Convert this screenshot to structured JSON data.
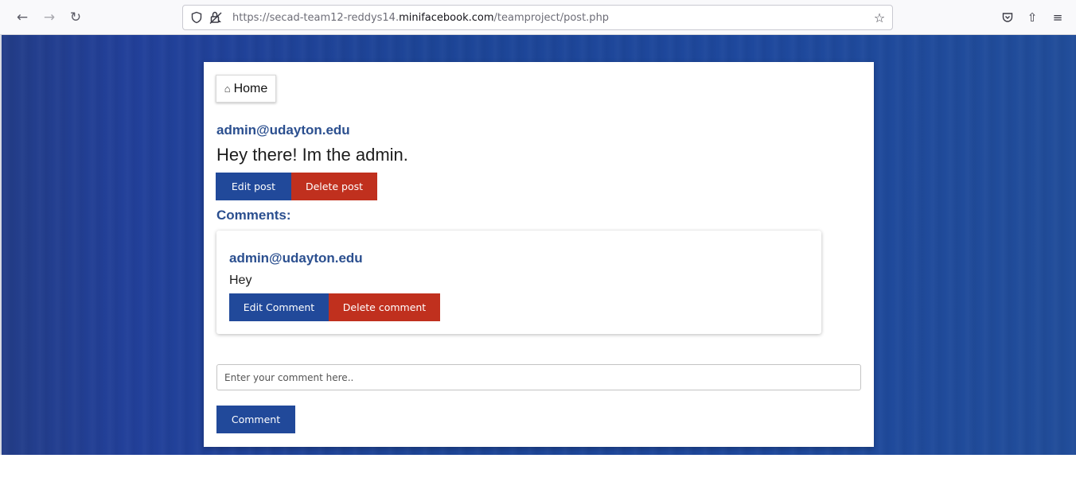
{
  "browser": {
    "url_prefix": "https://secad-team12-reddys14.",
    "url_domain": "minifacebook.com",
    "url_path": "/teamproject/post.php",
    "icons": {
      "back": "←",
      "forward": "→",
      "reload": "↻",
      "bookmark": "☆",
      "pocket": "pocket-icon",
      "extensions": "⇧",
      "menu": "≡"
    }
  },
  "nav": {
    "home_label": "Home",
    "home_icon": "⌂"
  },
  "post": {
    "author": "admin@udayton.edu",
    "body": "Hey there! Im the admin.",
    "edit_label": "Edit post",
    "delete_label": "Delete post"
  },
  "comments": {
    "heading": "Comments:",
    "items": [
      {
        "author": "admin@udayton.edu",
        "body": "Hey",
        "edit_label": "Edit Comment",
        "delete_label": "Delete comment"
      }
    ]
  },
  "new_comment": {
    "placeholder": "Enter your comment here..",
    "submit_label": "Comment"
  },
  "colors": {
    "primary_blue": "#21499a",
    "danger_red": "#c0301e",
    "heading_blue": "#2b4f8f"
  }
}
